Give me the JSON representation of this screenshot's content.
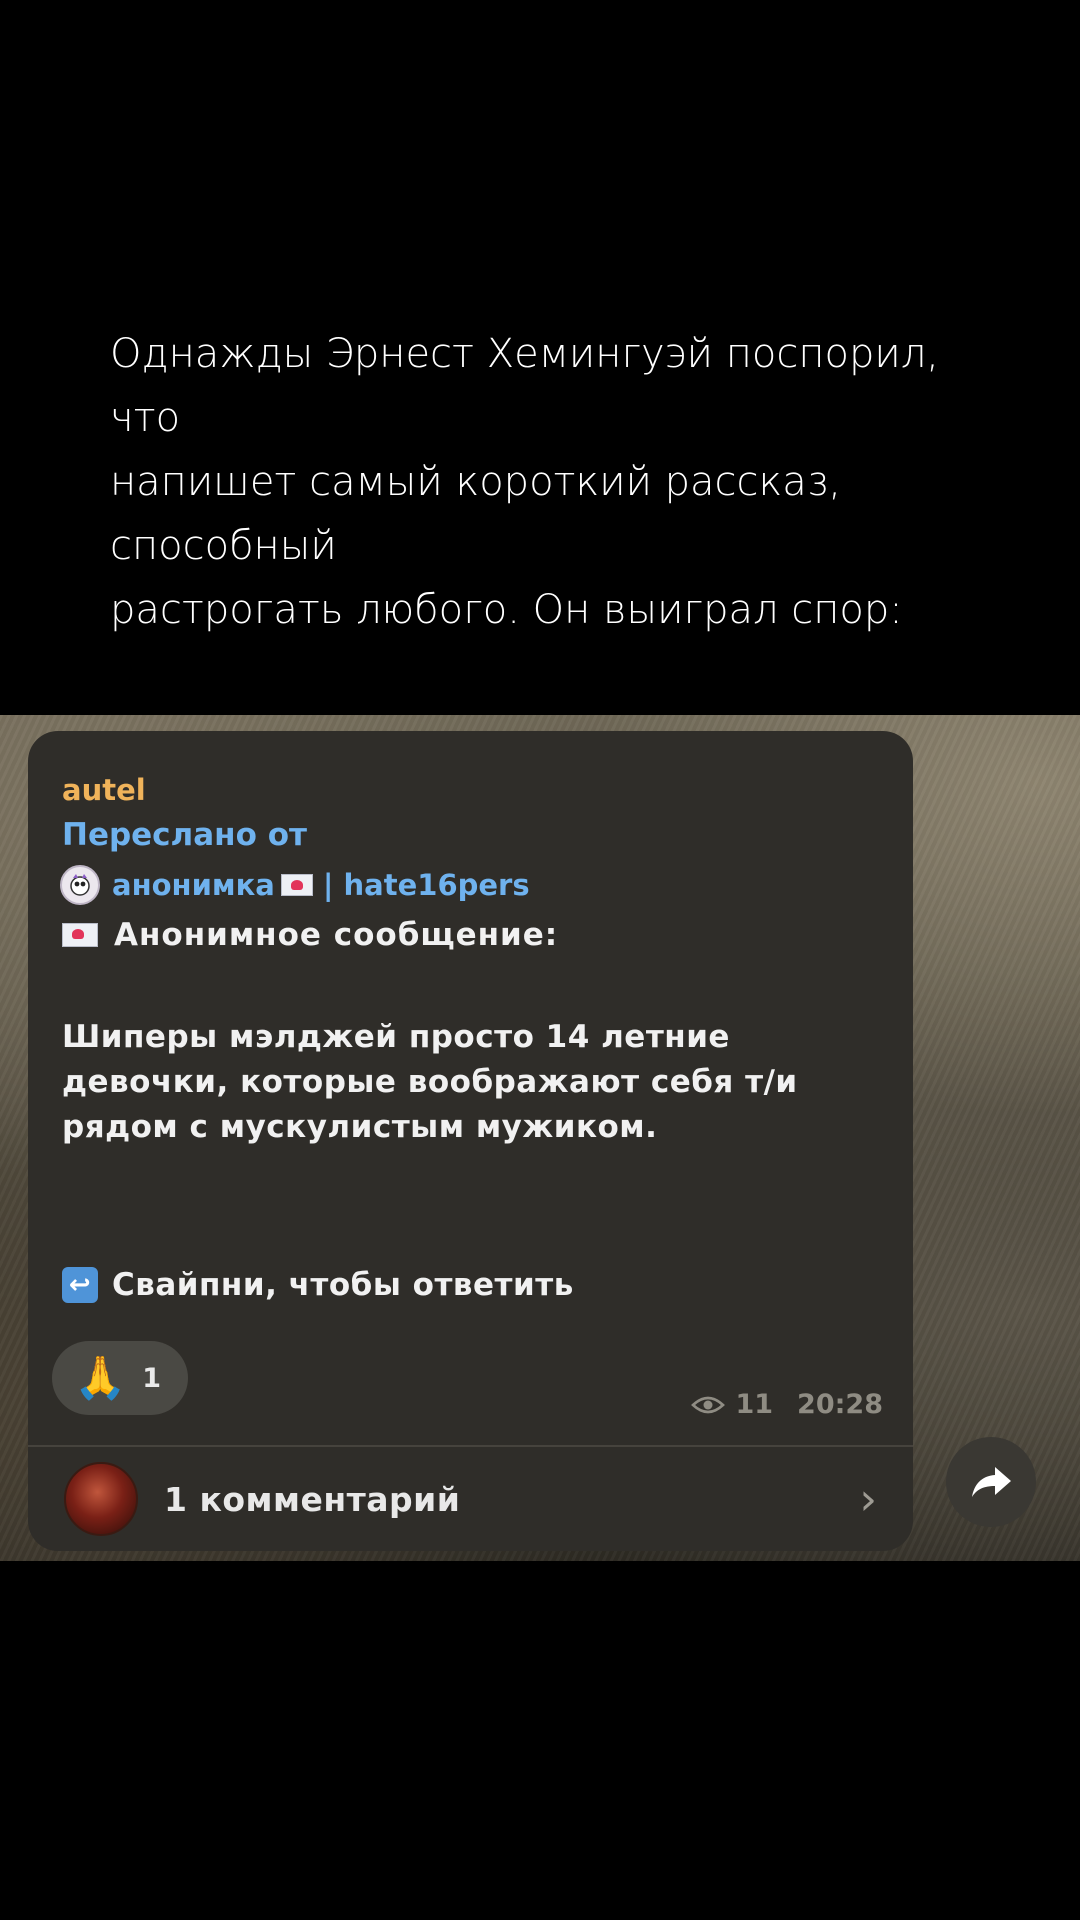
{
  "caption": {
    "lines": [
      "Однажды Эрнест Хемингуэй поспорил,",
      "что",
      "напишет самый короткий рассказ,",
      "способный",
      "растрогать любого. Он выиграл спор:"
    ]
  },
  "message": {
    "sender": "autel",
    "forwarded_label": "Переслано от",
    "forwarded_source_name": "анонимка",
    "forwarded_source_suffix": "| hate16pers",
    "title": "Анонимное сообщение:",
    "body": "Шиперы мэлджей просто 14 летние девочки, которые воображают себя т/и рядом с мускулистым мужиком.",
    "swipe_hint": "Свайпни, чтобы ответить",
    "reaction": {
      "emoji": "🙏",
      "count": "1"
    },
    "views": "11",
    "time": "20:28",
    "comments": "1 комментарий"
  },
  "colors": {
    "sender": "#f0b35a",
    "link": "#6fb2ee",
    "bubble": "#2f2d29"
  },
  "icons": {
    "envelope": "love-letter-icon",
    "swipe": "return-arrow-icon",
    "views": "eye-icon",
    "chevron": "chevron-right-icon",
    "share": "share-arrow-icon"
  }
}
